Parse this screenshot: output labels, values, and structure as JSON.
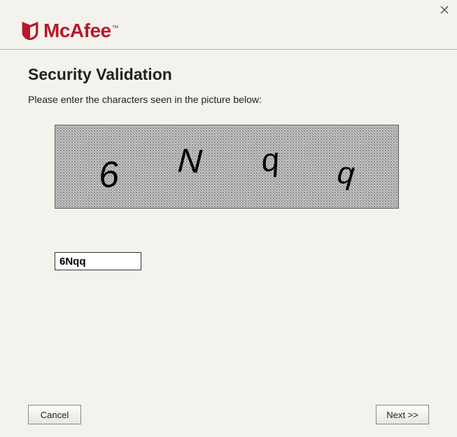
{
  "brand": {
    "name": "McAfee",
    "tm": "™",
    "color": "#b8182a"
  },
  "page": {
    "title": "Security Validation",
    "instruction": "Please enter the characters seen in the picture below:"
  },
  "captcha": {
    "chars": [
      "6",
      "N",
      "q",
      "q"
    ],
    "input_value": "6Nqq"
  },
  "buttons": {
    "cancel": "Cancel",
    "next": "Next >>"
  }
}
